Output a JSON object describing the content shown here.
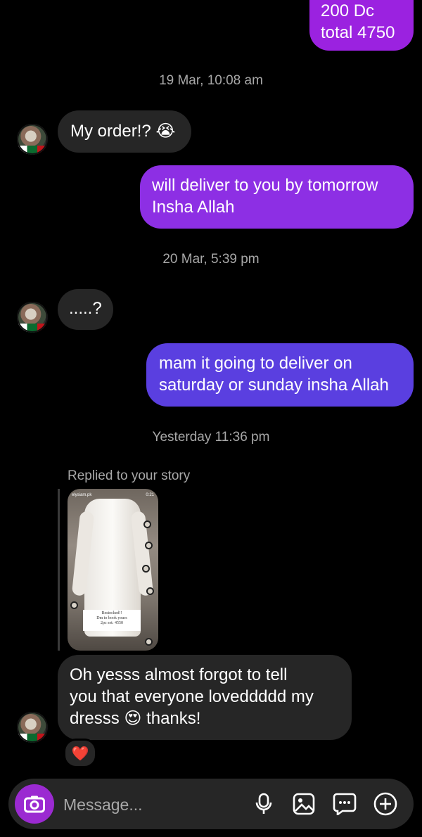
{
  "colors": {
    "background": "#000000",
    "received_bubble": "#262626",
    "sent_gradient_1": "#9b22e0",
    "sent_gradient_2": "#6e3ae6",
    "sent_gradient_3": "#5a3fe0",
    "timestamp": "#a8a8a8",
    "camera_button": "#9b2ad1",
    "heart": "#e8112d"
  },
  "messages": {
    "top_sent": {
      "line1": "200 Dc",
      "line2": "total 4750"
    },
    "ts1": "19 Mar, 10:08 am",
    "recv1": {
      "text": "My order!?",
      "emoji": "😭"
    },
    "sent1": {
      "line1": "will deliver to  you by tomorrow",
      "line2": "Insha Allah"
    },
    "ts2": "20 Mar, 5:39 pm",
    "recv2": {
      "text": ".....?"
    },
    "sent2": {
      "line1": "mam it going to deliver on",
      "line2": "saturday or sunday insha Allah"
    },
    "ts3": "Yesterday 11:36 pm",
    "story_reply": {
      "label": "Replied to your story",
      "handle": "elysiam.pk",
      "time": "0:21",
      "card_line1": "Restocked!!",
      "card_line2": "Dm to book yours",
      "card_line3": "2pc set: 4550"
    },
    "recv3": {
      "line1": "Oh yesss almost forgot to tell",
      "line2": "you that everyone loveddddd my",
      "line3a": "dresss",
      "emoji": "😍",
      "line3b": "thanks!"
    },
    "reaction": "❤️"
  },
  "composer": {
    "placeholder": "Message...",
    "icons": [
      "camera-icon",
      "microphone-icon",
      "gallery-icon",
      "sticker-icon",
      "plus-icon"
    ]
  }
}
